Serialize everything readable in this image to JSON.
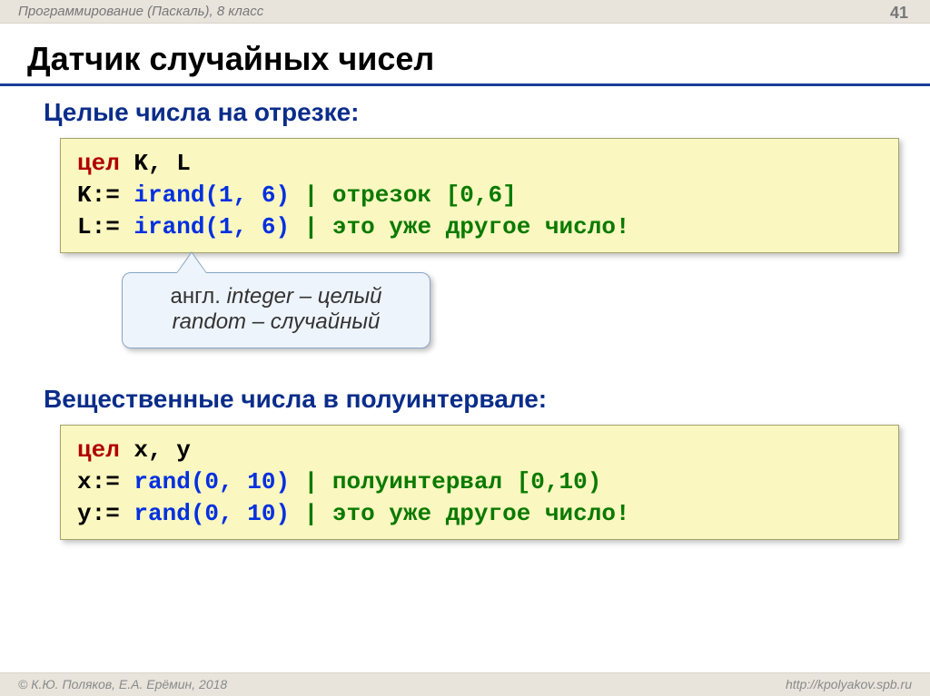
{
  "header": {
    "left": "Программирование (Паскаль), 8 класс",
    "page": "41"
  },
  "title": "Датчик случайных чисел",
  "subheadings": {
    "integers": "Целые числа на отрезке:",
    "reals": "Вещественные числа в полуинтервале:"
  },
  "code_box1": {
    "l1": {
      "kw": "цел",
      "vars": " K, L"
    },
    "l2": {
      "lhs": "K:=",
      "sp": " ",
      "fn": "irand(1,",
      "sp2": " ",
      "arg2": "6)",
      "cmt": " | отрезок [0,6]"
    },
    "l3": {
      "lhs": "L:=",
      "sp": " ",
      "fn": "irand(1,",
      "sp2": " ",
      "arg2": "6)",
      "cmt": " | это уже другое число!"
    }
  },
  "callout": {
    "line1a": "англ. ",
    "line1b": "integer",
    "line1c": " – целый",
    "line2a": "random",
    "line2b": " – случайный"
  },
  "code_box2": {
    "l1": {
      "kw": "цел",
      "vars": " x, y"
    },
    "l2": {
      "lhs": "x:=",
      "sp": " ",
      "fn": "rand(0,",
      "sp2": " ",
      "arg2": "10)",
      "cmt": " | полуинтервал [0,10)"
    },
    "l3": {
      "lhs": "y:=",
      "sp": " ",
      "fn": "rand(0,",
      "sp2": " ",
      "arg2": "10)",
      "cmt": " | это уже другое число!"
    }
  },
  "footer": {
    "left": "© К.Ю. Поляков, Е.А. Ерёмин, 2018",
    "right": "http://kpolyakov.spb.ru"
  }
}
